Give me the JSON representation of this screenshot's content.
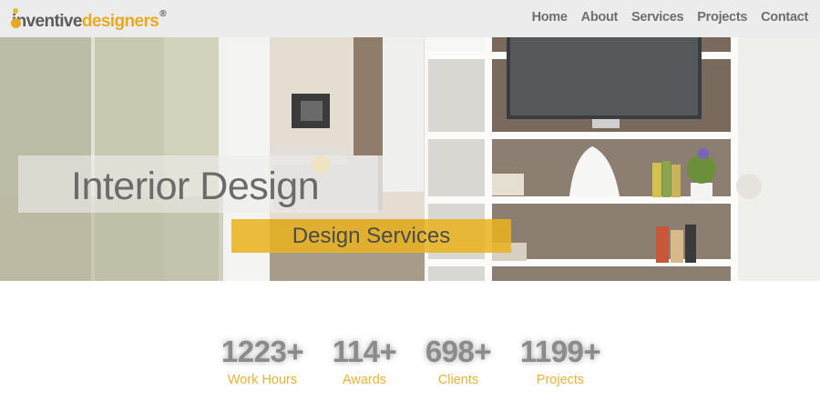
{
  "header": {
    "logo": {
      "part1": "inventive",
      "part2": "designers",
      "registered": "®"
    },
    "nav": [
      {
        "label": "Home"
      },
      {
        "label": "About"
      },
      {
        "label": "Services"
      },
      {
        "label": "Projects"
      },
      {
        "label": "Contact"
      }
    ]
  },
  "hero": {
    "title": "Interior Design",
    "subtitle": "Design Services"
  },
  "stats": [
    {
      "value": "1223+",
      "label": "Work Hours"
    },
    {
      "value": "114+",
      "label": "Awards"
    },
    {
      "value": "698+",
      "label": "Clients"
    },
    {
      "value": "1199+",
      "label": "Projects"
    }
  ],
  "colors": {
    "accent": "#e9b23a",
    "header_bg": "#ececec",
    "nav_text": "#6f6f6f",
    "stat_number": "#8b8b8b"
  }
}
